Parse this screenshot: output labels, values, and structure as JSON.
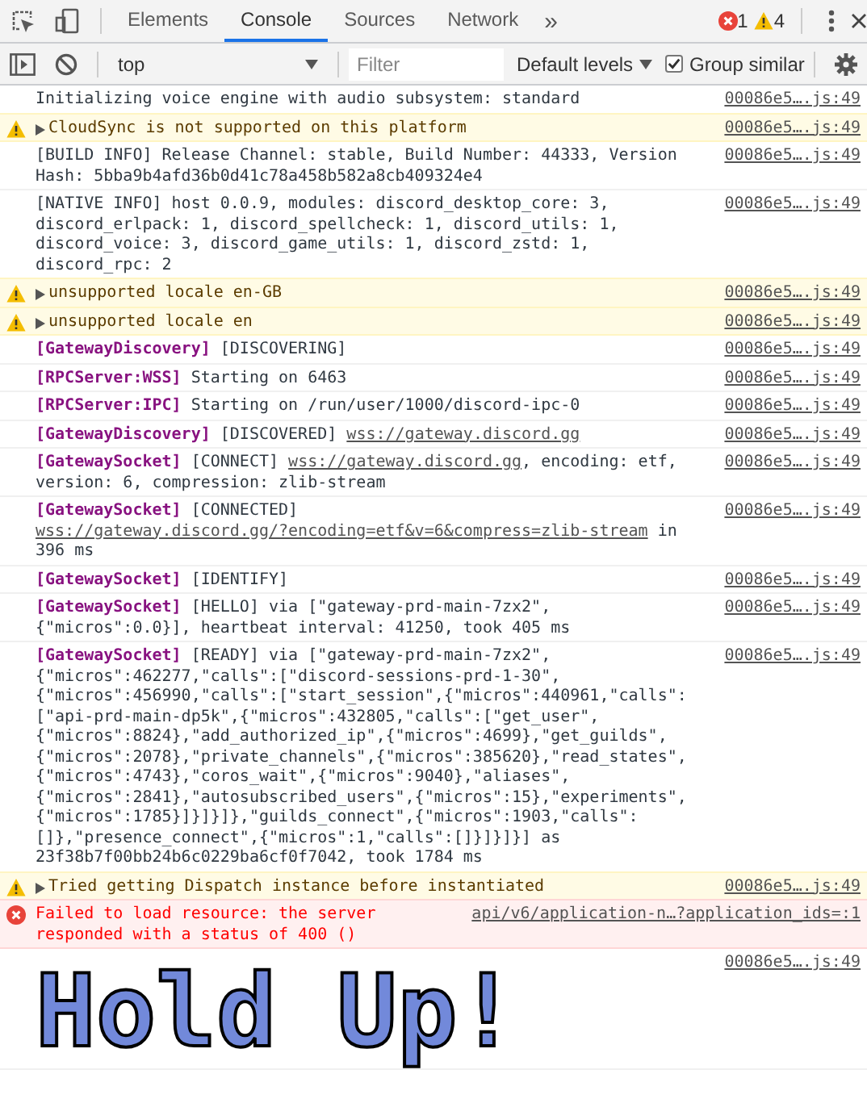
{
  "toolbar": {
    "tabs": [
      {
        "label": "Elements",
        "selected": false
      },
      {
        "label": "Console",
        "selected": true
      },
      {
        "label": "Sources",
        "selected": false
      },
      {
        "label": "Network",
        "selected": false
      }
    ],
    "overflow": "»",
    "error_count": "1",
    "warning_count": "4"
  },
  "console_bar": {
    "context": "top",
    "filter": {
      "placeholder": "Filter"
    },
    "levels": "Default levels",
    "group_similar": {
      "label": "Group similar",
      "checked": true
    }
  },
  "messages": [
    {
      "kind": "log",
      "expandable": false,
      "parts": [
        {
          "kind": "text",
          "text": "Initializing voice engine with audio subsystem: standard"
        }
      ],
      "source": "00086e5….js:49"
    },
    {
      "kind": "warning",
      "expandable": true,
      "parts": [
        {
          "kind": "text",
          "text": "CloudSync is not supported on this platform"
        }
      ],
      "source": "00086e5….js:49"
    },
    {
      "kind": "log",
      "expandable": false,
      "parts": [
        {
          "kind": "text",
          "text": "[BUILD INFO] Release Channel: stable, Build Number: 44333, Version Hash: 5bba9b4afd36b0d41c78a458b582a8cb409324e4"
        }
      ],
      "source": "00086e5….js:49"
    },
    {
      "kind": "log",
      "expandable": false,
      "parts": [
        {
          "kind": "text",
          "text": "[NATIVE INFO] host 0.0.9, modules: discord_desktop_core: 3, discord_erlpack: 1, discord_spellcheck: 1, discord_utils: 1, discord_voice: 3, discord_game_utils: 1, discord_zstd: 1, discord_rpc: 2"
        }
      ],
      "source": "00086e5….js:49"
    },
    {
      "kind": "warning",
      "expandable": true,
      "parts": [
        {
          "kind": "text",
          "text": "unsupported locale en-GB"
        }
      ],
      "source": "00086e5….js:49"
    },
    {
      "kind": "warning",
      "expandable": true,
      "parts": [
        {
          "kind": "text",
          "text": "unsupported locale en"
        }
      ],
      "source": "00086e5….js:49"
    },
    {
      "kind": "log",
      "expandable": false,
      "parts": [
        {
          "kind": "tag",
          "text": "[GatewayDiscovery]"
        },
        {
          "kind": "text",
          "text": " [DISCOVERING]"
        }
      ],
      "source": "00086e5….js:49"
    },
    {
      "kind": "log",
      "expandable": false,
      "parts": [
        {
          "kind": "tag",
          "text": "[RPCServer:WSS]"
        },
        {
          "kind": "text",
          "text": " Starting on 6463"
        }
      ],
      "source": "00086e5….js:49"
    },
    {
      "kind": "log",
      "expandable": false,
      "parts": [
        {
          "kind": "tag",
          "text": "[RPCServer:IPC]"
        },
        {
          "kind": "text",
          "text": " Starting on /run/user/1000/discord-ipc-0"
        }
      ],
      "source": "00086e5….js:49"
    },
    {
      "kind": "log",
      "expandable": false,
      "parts": [
        {
          "kind": "tag",
          "text": "[GatewayDiscovery]"
        },
        {
          "kind": "text",
          "text": " [DISCOVERED] "
        },
        {
          "kind": "link",
          "text": "wss://gateway.discord.gg"
        }
      ],
      "source": "00086e5….js:49"
    },
    {
      "kind": "log",
      "expandable": false,
      "parts": [
        {
          "kind": "tag",
          "text": "[GatewaySocket]"
        },
        {
          "kind": "text",
          "text": " [CONNECT] "
        },
        {
          "kind": "link",
          "text": "wss://gateway.discord.gg"
        },
        {
          "kind": "text",
          "text": ", encoding: etf, version: 6, compression: zlib-stream"
        }
      ],
      "source": "00086e5….js:49"
    },
    {
      "kind": "log",
      "expandable": false,
      "parts": [
        {
          "kind": "tag",
          "text": "[GatewaySocket]"
        },
        {
          "kind": "text",
          "text": " [CONNECTED] "
        },
        {
          "kind": "link",
          "text": "wss://gateway.discord.gg/?encoding=etf&v=6&compress=zlib-stream"
        },
        {
          "kind": "text",
          "text": " in 396 ms"
        }
      ],
      "source": "00086e5….js:49"
    },
    {
      "kind": "log",
      "expandable": false,
      "parts": [
        {
          "kind": "tag",
          "text": "[GatewaySocket]"
        },
        {
          "kind": "text",
          "text": " [IDENTIFY]"
        }
      ],
      "source": "00086e5….js:49"
    },
    {
      "kind": "log",
      "expandable": false,
      "parts": [
        {
          "kind": "tag",
          "text": "[GatewaySocket]"
        },
        {
          "kind": "text",
          "text": " [HELLO] via [\"gateway-prd-main-7zx2\", {\"micros\":0.0}], heartbeat interval: 41250, took 405 ms"
        }
      ],
      "source": "00086e5….js:49"
    },
    {
      "kind": "log",
      "expandable": false,
      "parts": [
        {
          "kind": "tag",
          "text": "[GatewaySocket]"
        },
        {
          "kind": "text",
          "text": " [READY] via [\"gateway-prd-main-7zx2\", {\"micros\":462277,\"calls\":[\"discord-sessions-prd-1-30\", {\"micros\":456990,\"calls\":[\"start_session\",{\"micros\":440961,\"calls\":[\"api-prd-main-dp5k\",{\"micros\":432805,\"calls\":[\"get_user\", {\"micros\":8824},\"add_authorized_ip\",{\"micros\":4699},\"get_guilds\", {\"micros\":2078},\"private_channels\",{\"micros\":385620},\"read_states\", {\"micros\":4743},\"coros_wait\",{\"micros\":9040},\"aliases\", {\"micros\":2841},\"autosubscribed_users\",{\"micros\":15},\"experiments\", {\"micros\":1785}]}]}]},\"guilds_connect\",{\"micros\":1903,\"calls\": []},\"presence_connect\",{\"micros\":1,\"calls\":[]}]}]}] as 23f38b7f00bb24b6c0229ba6cf0f7042, took 1784 ms"
        }
      ],
      "source": "00086e5….js:49"
    },
    {
      "kind": "warning",
      "expandable": true,
      "parts": [
        {
          "kind": "text",
          "text": "Tried getting Dispatch instance before instantiated"
        }
      ],
      "source": "00086e5….js:49"
    },
    {
      "kind": "error",
      "expandable": false,
      "parts": [
        {
          "kind": "text",
          "text": "Failed to load resource: the server responded with a status of 400 ()"
        }
      ],
      "source": "api/v6/application-n…?application_ids=:1"
    },
    {
      "kind": "styled",
      "expandable": false,
      "parts": [
        {
          "kind": "text",
          "text": "Hold Up!"
        }
      ],
      "source": "00086e5….js:49"
    }
  ]
}
